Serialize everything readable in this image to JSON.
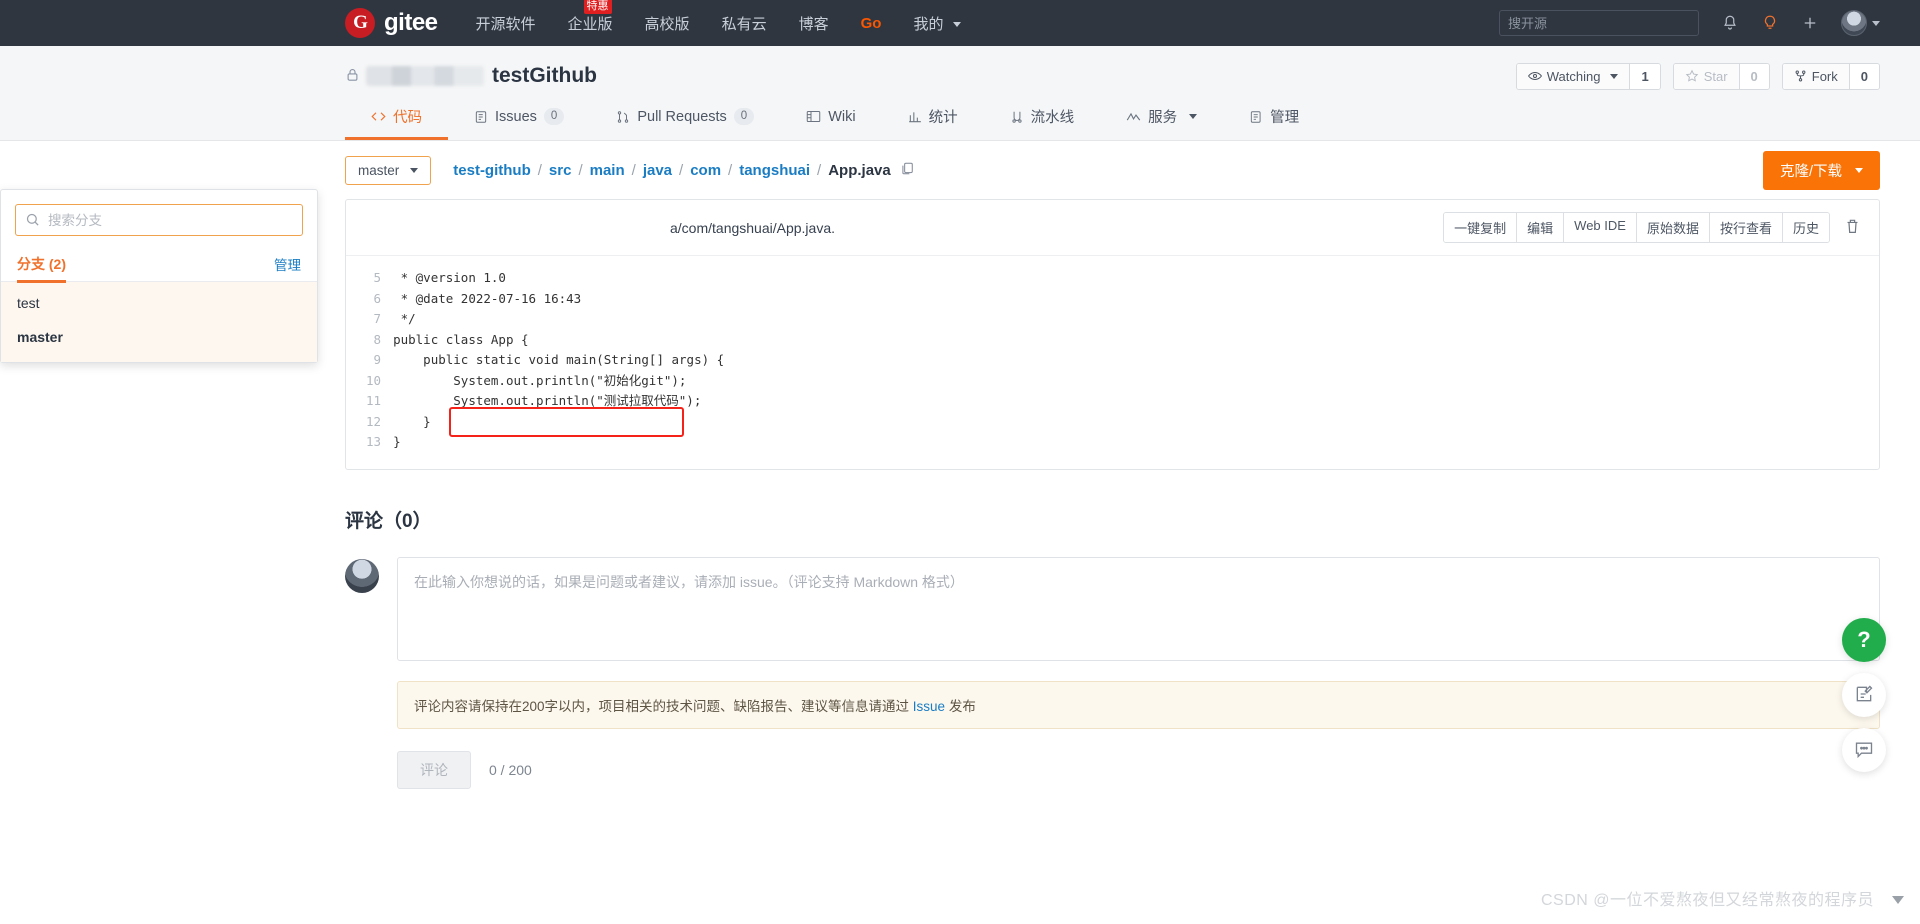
{
  "topnav": {
    "brand_letter": "G",
    "brand_text": "gitee",
    "links": [
      {
        "label": "开源软件",
        "badge": null
      },
      {
        "label": "企业版",
        "badge": "特惠"
      },
      {
        "label": "高校版",
        "badge": null
      },
      {
        "label": "私有云",
        "badge": null
      },
      {
        "label": "博客",
        "badge": null
      },
      {
        "label": "Go",
        "badge": null
      },
      {
        "label": "我的",
        "badge": null
      }
    ],
    "search_placeholder": "搜开源",
    "icons": [
      "bell-icon",
      "lightbulb-icon",
      "plus-icon",
      "avatar"
    ]
  },
  "repo": {
    "owner_redacted": "",
    "name": "testGithub",
    "watching_label": "Watching",
    "watching_count": "1",
    "star_label": "Star",
    "star_count": "0",
    "fork_label": "Fork",
    "fork_count": "0",
    "tabs": [
      {
        "label": "代码",
        "icon": "code-icon",
        "count": null,
        "active": true
      },
      {
        "label": "Issues",
        "icon": "issue-icon",
        "count": "0",
        "active": false
      },
      {
        "label": "Pull Requests",
        "icon": "pr-icon",
        "count": "0",
        "active": false
      },
      {
        "label": "Wiki",
        "icon": "wiki-icon",
        "count": null,
        "active": false
      },
      {
        "label": "统计",
        "icon": "stats-icon",
        "count": null,
        "active": false
      },
      {
        "label": "流水线",
        "icon": "pipeline-icon",
        "count": null,
        "active": false
      },
      {
        "label": "服务",
        "icon": "service-icon",
        "count": null,
        "active": false,
        "caret": true
      },
      {
        "label": "管理",
        "icon": "manage-icon",
        "count": null,
        "active": false
      }
    ]
  },
  "toolbar": {
    "branch_label": "master",
    "clone_label": "克隆/下载",
    "breadcrumb": [
      {
        "text": "test-github",
        "link": true
      },
      {
        "text": "src",
        "link": true
      },
      {
        "text": "main",
        "link": true
      },
      {
        "text": "java",
        "link": true
      },
      {
        "text": "com",
        "link": true
      },
      {
        "text": "tangshuai",
        "link": true
      },
      {
        "text": "App.java",
        "link": false
      }
    ]
  },
  "branch_popover": {
    "search_placeholder": "搜索分支",
    "tab_label": "分支 (2)",
    "manage_label": "管理",
    "items": [
      {
        "name": "test",
        "selected": false
      },
      {
        "name": "master",
        "selected": true
      }
    ]
  },
  "file_panel": {
    "commit_message_tail": "a/com/tangshuai/App.java.",
    "tools": [
      "一键复制",
      "编辑",
      "Web IDE",
      "原始数据",
      "按行查看",
      "历史"
    ],
    "delete_icon": "trash-icon",
    "lines": [
      {
        "no": "5",
        "text": " * @version 1.0"
      },
      {
        "no": "6",
        "text": " * @date 2022-07-16 16:43"
      },
      {
        "no": "7",
        "text": " */"
      },
      {
        "no": "8",
        "text": "public class App {"
      },
      {
        "no": "9",
        "text": "    public static void main(String[] args) {"
      },
      {
        "no": "10",
        "text": "        System.out.println(\"初始化git\");"
      },
      {
        "no": "11",
        "text": "        System.out.println(\"测试拉取代码\");"
      },
      {
        "no": "12",
        "text": "    }"
      },
      {
        "no": "13",
        "text": "}"
      }
    ]
  },
  "comments": {
    "title": "评论（0）",
    "textarea_placeholder": "在此输入你想说的话，如果是问题或者建议，请添加 issue。（评论支持 Markdown 格式）",
    "notice_prefix": "评论内容请保持在200字以内，项目相关的技术问题、缺陷报告、建议等信息请通过 ",
    "notice_link": "Issue",
    "notice_suffix": " 发布",
    "submit_label": "评论",
    "counter": "0 / 200"
  },
  "floating": {
    "help_label": "?",
    "feedback_icon": "edit-note-icon",
    "chat_icon": "chat-bubble-icon"
  },
  "watermark": "CSDN @一位不爱熬夜但又经常熬夜的程序员",
  "colors": {
    "accent": "#f0712c",
    "brand_red": "#c71d23",
    "link_blue": "#1a7dc4",
    "nav_bg": "#2f3640",
    "clone_orange": "#f97307",
    "highlight_red": "#f5221a"
  }
}
